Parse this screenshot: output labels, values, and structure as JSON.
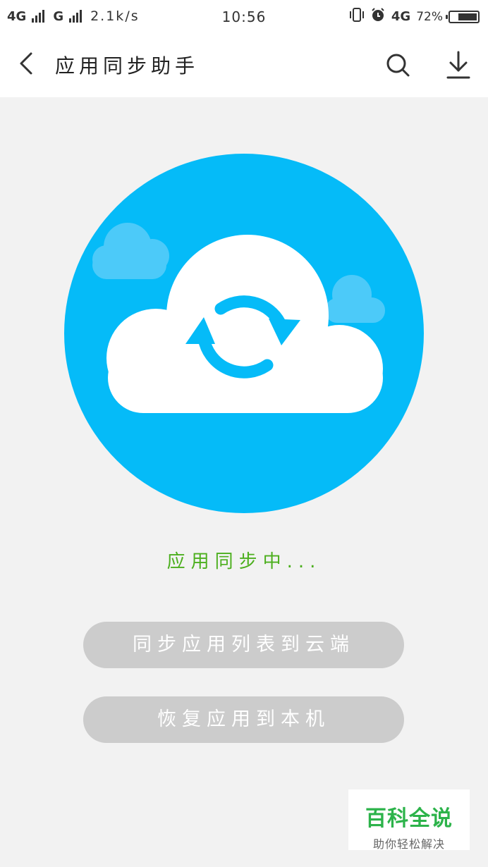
{
  "status_bar": {
    "network1": "4G",
    "network2": "G",
    "speed": "2.1k/s",
    "time": "10:56",
    "network3": "4G",
    "battery_level": 72,
    "battery_text": "72%"
  },
  "header": {
    "title": "应用同步助手",
    "icons": [
      "back-icon",
      "search-icon",
      "download-icon"
    ]
  },
  "main": {
    "status_text": "应用同步中...",
    "sync_button_label": "同步应用列表到云端",
    "restore_button_label": "恢复应用到本机"
  },
  "watermark": {
    "title": "百科全说",
    "subtitle": "助你轻松解决"
  },
  "colors": {
    "accent": "#05bbf8",
    "status_green": "#4caf1e",
    "button_disabled": "#cccccc",
    "background": "#f2f2f2"
  }
}
